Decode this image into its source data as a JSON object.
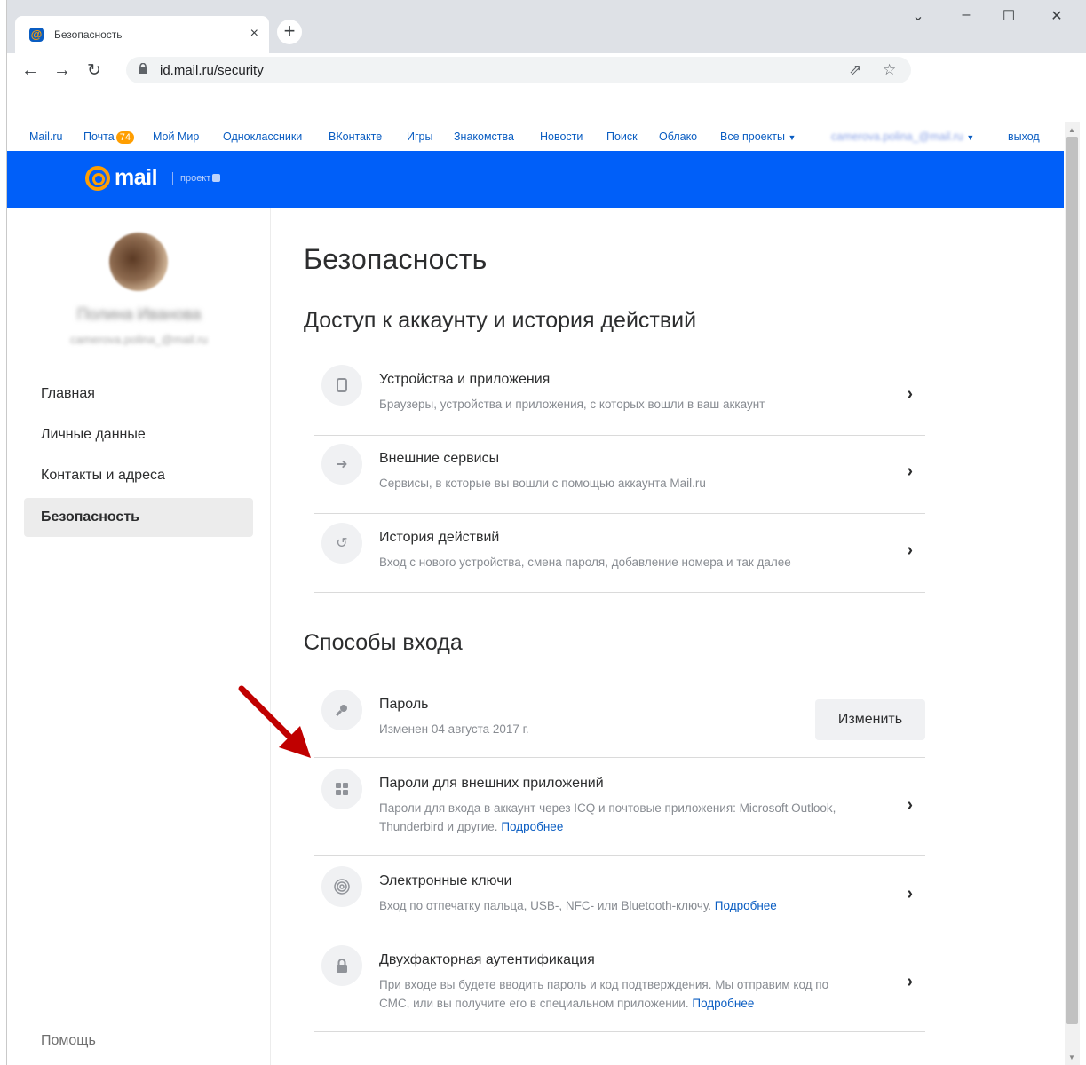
{
  "browser": {
    "tab_title": "Безопасность",
    "tab_close": "×",
    "new_tab": "+",
    "url": "id.mail.ru/security",
    "window_controls": [
      "⌄",
      "–",
      "☐",
      "✕"
    ]
  },
  "portal_bar": {
    "links": [
      "Mail.ru",
      "Почта",
      "Мой Мир",
      "Одноклассники",
      "ВКонтакте",
      "Игры",
      "Знакомства",
      "Новости",
      "Поиск",
      "Облако",
      "Все проекты"
    ],
    "mail_badge": "74",
    "user_email_blurred": "camerova.polina_@mail.ru",
    "logout": "выход"
  },
  "brand": {
    "logo_text": "mail",
    "project_label": "проект"
  },
  "sidebar": {
    "user_name_blurred": "Полина Иванова",
    "user_email_blurred": "camerova.polina_@mail.ru",
    "menu": [
      {
        "label": "Главная",
        "active": false
      },
      {
        "label": "Личные данные",
        "active": false
      },
      {
        "label": "Контакты и адреса",
        "active": false
      },
      {
        "label": "Безопасность",
        "active": true
      }
    ],
    "help": "Помощь"
  },
  "main": {
    "title": "Безопасность",
    "section1_title": "Доступ к аккаунту и история действий",
    "section1_items": [
      {
        "title": "Устройства и приложения",
        "subtitle": "Браузеры, устройства и приложения, с которых вошли в ваш аккаунт",
        "icon": "phone-icon"
      },
      {
        "title": "Внешние сервисы",
        "subtitle": "Сервисы, в которые вы вошли с помощью аккаунта Mail.ru",
        "icon": "arrow-right-icon"
      },
      {
        "title": "История действий",
        "subtitle": "Вход с нового устройства, смена пароля, добавление номера и так далее",
        "icon": "history-icon"
      }
    ],
    "section2_title": "Способы входа",
    "password": {
      "title": "Пароль",
      "subtitle": "Изменен 04 августа 2017 г.",
      "button": "Изменить"
    },
    "section2_items": [
      {
        "title": "Пароли для внешних приложений",
        "subtitle": "Пароли для входа в аккаунт через ICQ и почтовые приложения: Microsoft Outlook, Thunderbird и другие.",
        "more": "Подробнее",
        "icon": "apps-grid-icon"
      },
      {
        "title": "Электронные ключи",
        "subtitle": "Вход по отпечатку пальца, USB-, NFC- или Bluetooth-ключу.",
        "more": "Подробнее",
        "icon": "fingerprint-icon"
      },
      {
        "title": "Двухфакторная аутентификация",
        "subtitle": "При входе вы будете вводить пароль и код подтверждения. Мы отправим код по СМС, или вы получите его в специальном приложении.",
        "more": "Подробнее",
        "icon": "lock-icon"
      }
    ]
  },
  "colors": {
    "brand_blue": "#005ff9",
    "accent_orange": "#ff9e00",
    "link_blue": "#0a5dc2",
    "annotation_arrow": "#c00000"
  }
}
